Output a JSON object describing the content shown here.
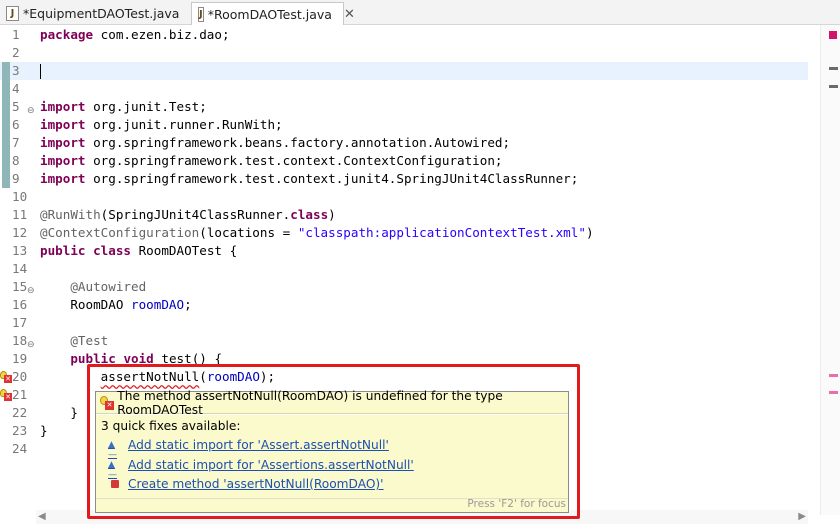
{
  "tabs": [
    {
      "label": "*EquipmentDAOTest.java",
      "active": false
    },
    {
      "label": "*RoomDAOTest.java",
      "active": true,
      "close": "✕"
    }
  ],
  "file_icon_letter": "J",
  "editor": {
    "lines": [
      {
        "n": "1",
        "text": "package com.ezen.biz.dao;"
      },
      {
        "n": "2",
        "text": ""
      },
      {
        "n": "3",
        "text": ""
      },
      {
        "n": "4",
        "text": ""
      },
      {
        "n": "5",
        "text": "import org.junit.Test;"
      },
      {
        "n": "6",
        "text": "import org.junit.runner.RunWith;"
      },
      {
        "n": "7",
        "text": "import org.springframework.beans.factory.annotation.Autowired;"
      },
      {
        "n": "8",
        "text": "import org.springframework.test.context.ContextConfiguration;"
      },
      {
        "n": "9",
        "text": "import org.springframework.test.context.junit4.SpringJUnit4ClassRunner;"
      },
      {
        "n": "10",
        "text": ""
      },
      {
        "n": "11",
        "text": "@RunWith(SpringJUnit4ClassRunner.class)"
      },
      {
        "n": "12",
        "text": "@ContextConfiguration(locations = \"classpath:applicationContextTest.xml\")"
      },
      {
        "n": "13",
        "text": "public class RoomDAOTest {"
      },
      {
        "n": "14",
        "text": ""
      },
      {
        "n": "15",
        "text": "    @Autowired"
      },
      {
        "n": "16",
        "text": "    RoomDAO roomDAO;"
      },
      {
        "n": "17",
        "text": ""
      },
      {
        "n": "18",
        "text": "    @Test"
      },
      {
        "n": "19",
        "text": "    public void test() {"
      },
      {
        "n": "20",
        "text": "        assertNotNull(roomDAO);"
      },
      {
        "n": "21",
        "text": ""
      },
      {
        "n": "22",
        "text": "    }"
      },
      {
        "n": "23",
        "text": "}"
      },
      {
        "n": "24",
        "text": ""
      }
    ]
  },
  "hover": {
    "message": "The method assertNotNull(RoomDAO) is undefined for the type RoomDAOTest",
    "quick_fix_title": "3 quick fixes available:",
    "fixes": [
      "Add static import for 'Assert.assertNotNull'",
      "Add static import for 'Assertions.assertNotNull'",
      "Create method 'assertNotNull(RoomDAO)'"
    ],
    "focus_hint": "Press 'F2' for focus"
  },
  "colors": {
    "keyword": "#7f0055",
    "string": "#2a00ff",
    "field": "#0000c0",
    "annotation": "#646464",
    "current_line": "#e8f2fe",
    "highlight_box": "#e11b1b",
    "hover_bg": "#fafacc",
    "error": "#d33333"
  }
}
